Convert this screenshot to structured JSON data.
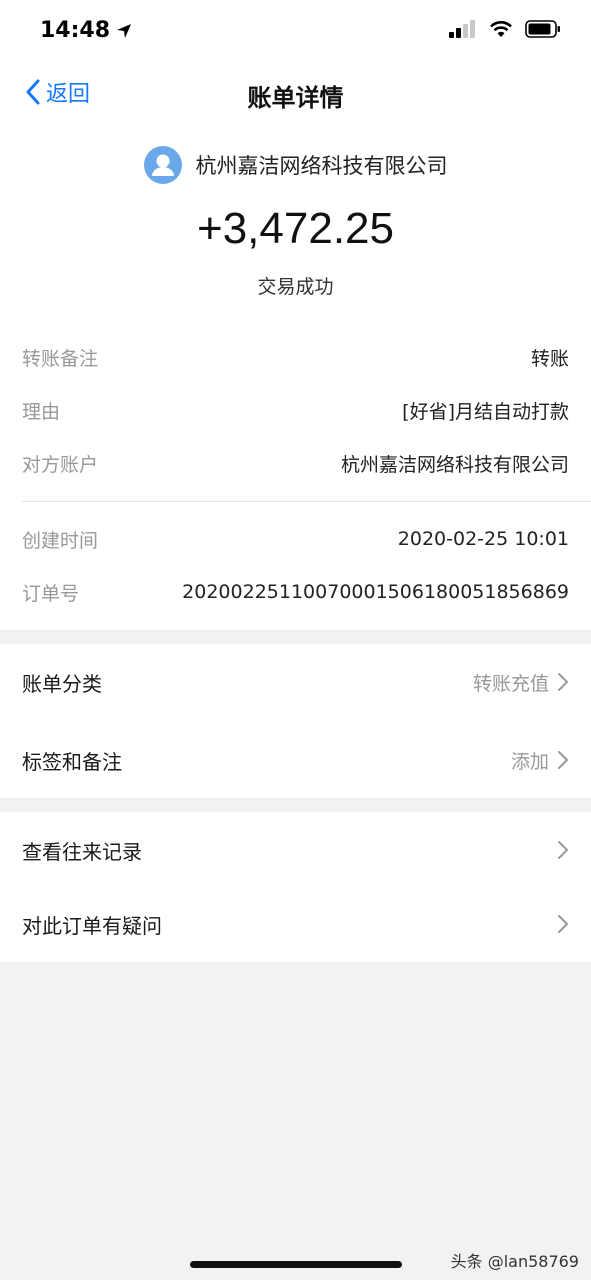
{
  "status_bar": {
    "time": "14:48"
  },
  "nav": {
    "back_label": "返回",
    "title": "账单详情"
  },
  "transaction": {
    "payee": "杭州嘉洁网络科技有限公司",
    "amount": "+3,472.25",
    "status": "交易成功"
  },
  "details": [
    {
      "label": "转账备注",
      "value": "转账"
    },
    {
      "label": "理由",
      "value": "[好省]月结自动打款"
    },
    {
      "label": "对方账户",
      "value": "杭州嘉洁网络科技有限公司"
    },
    {
      "label": "创建时间",
      "value": "2020-02-25 10:01"
    },
    {
      "label": "订单号",
      "value": "20200225110070001506180051856869"
    }
  ],
  "settings": [
    {
      "label": "账单分类",
      "value": "转账充值"
    },
    {
      "label": "标签和备注",
      "value": "添加"
    }
  ],
  "actions": [
    {
      "label": "查看往来记录"
    },
    {
      "label": "对此订单有疑问"
    }
  ],
  "watermark": "头条 @lan58769",
  "colors": {
    "accent": "#1677ff",
    "avatar": "#6aa8ea",
    "background": "#f2f2f4"
  }
}
